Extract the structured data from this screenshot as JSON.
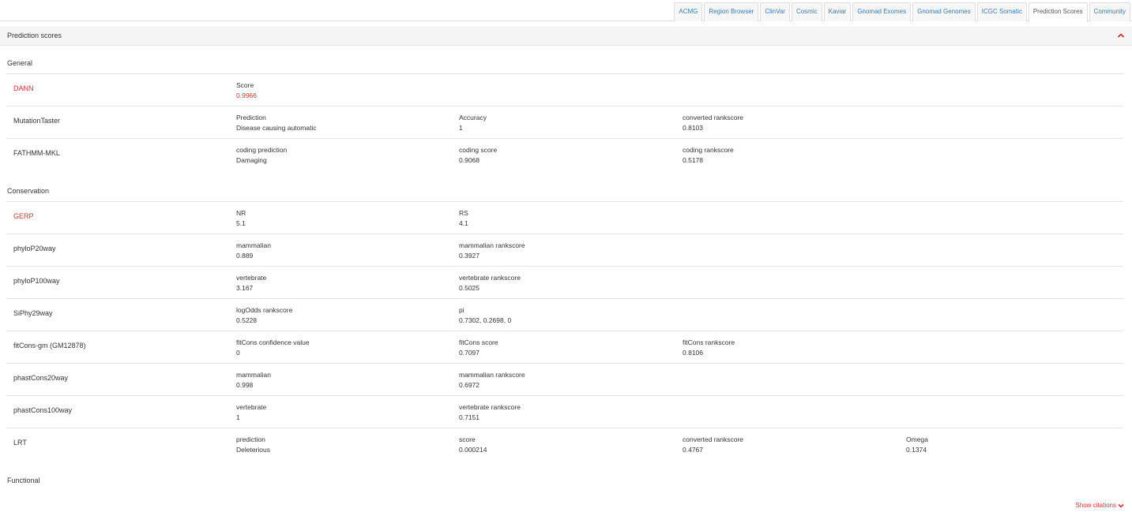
{
  "tabs": [
    {
      "label": "ACMG",
      "active": false
    },
    {
      "label": "Region Browser",
      "active": false
    },
    {
      "label": "ClinVar",
      "active": false
    },
    {
      "label": "Cosmic",
      "active": false
    },
    {
      "label": "Kaviar",
      "active": false
    },
    {
      "label": "Gnomad Exomes",
      "active": false
    },
    {
      "label": "Gnomad Genomes",
      "active": false
    },
    {
      "label": "ICGC Somatic",
      "active": false
    },
    {
      "label": "Prediction Scores",
      "active": true
    },
    {
      "label": "Community",
      "active": false
    }
  ],
  "panel": {
    "title": "Prediction scores",
    "collapse_icon": "chevron-up-icon"
  },
  "sections": {
    "general": {
      "title": "General",
      "rows": [
        {
          "name": "DANN",
          "highlight": true,
          "fields": [
            {
              "label": "Score",
              "value": "0.9966",
              "highlight": true
            }
          ]
        },
        {
          "name": "MutationTaster",
          "highlight": false,
          "fields": [
            {
              "label": "Prediction",
              "value": "Disease causing automatic"
            },
            {
              "label": "Accuracy",
              "value": "1"
            },
            {
              "label": "converted rankscore",
              "value": "0.8103"
            }
          ]
        },
        {
          "name": "FATHMM-MKL",
          "highlight": false,
          "fields": [
            {
              "label": "coding prediction",
              "value": "Damaging"
            },
            {
              "label": "coding score",
              "value": "0.9068"
            },
            {
              "label": "coding rankscore",
              "value": "0.5178"
            }
          ]
        }
      ]
    },
    "conservation": {
      "title": "Conservation",
      "rows": [
        {
          "name": "GERP",
          "highlight": true,
          "fields": [
            {
              "label": "NR",
              "value": "5.1"
            },
            {
              "label": "RS",
              "value": "4.1"
            }
          ]
        },
        {
          "name": "phyloP20way",
          "highlight": false,
          "fields": [
            {
              "label": "mammalian",
              "value": "0.889"
            },
            {
              "label": "mammalian rankscore",
              "value": "0.3927"
            }
          ]
        },
        {
          "name": "phyloP100way",
          "highlight": false,
          "fields": [
            {
              "label": "vertebrate",
              "value": "3.167"
            },
            {
              "label": "vertebrate rankscore",
              "value": "0.5025"
            }
          ]
        },
        {
          "name": "SiPhy29way",
          "highlight": false,
          "fields": [
            {
              "label": "logOdds rankscore",
              "value": "0.5228"
            },
            {
              "label": "pi",
              "value": "0.7302, 0.2698, 0"
            }
          ]
        },
        {
          "name": "fitCons-gm (GM12878)",
          "highlight": false,
          "fields": [
            {
              "label": "fitCons confidence value",
              "value": "0"
            },
            {
              "label": "fitCons score",
              "value": "0.7097"
            },
            {
              "label": "fitCons rankscore",
              "value": "0.8106"
            }
          ]
        },
        {
          "name": "phastCons20way",
          "highlight": false,
          "fields": [
            {
              "label": "mammalian",
              "value": "0.998"
            },
            {
              "label": "mammalian rankscore",
              "value": "0.6972"
            }
          ]
        },
        {
          "name": "phastCons100way",
          "highlight": false,
          "fields": [
            {
              "label": "vertebrate",
              "value": "1"
            },
            {
              "label": "vertebrate rankscore",
              "value": "0.7151"
            }
          ]
        },
        {
          "name": "LRT",
          "highlight": false,
          "fields": [
            {
              "label": "prediction",
              "value": "Deleterious"
            },
            {
              "label": "score",
              "value": "0.000214"
            },
            {
              "label": "converted rankscore",
              "value": "0.4767"
            },
            {
              "label": "Omega",
              "value": "0.1374"
            }
          ]
        }
      ]
    },
    "functional": {
      "title": "Functional"
    }
  },
  "footer": {
    "citations_label": "Show citations",
    "citations_icon": "chevron-down-icon"
  },
  "colors": {
    "accent_red": "#d0352f",
    "link_blue": "#337ab7",
    "header_bg": "#f5f5f5"
  }
}
